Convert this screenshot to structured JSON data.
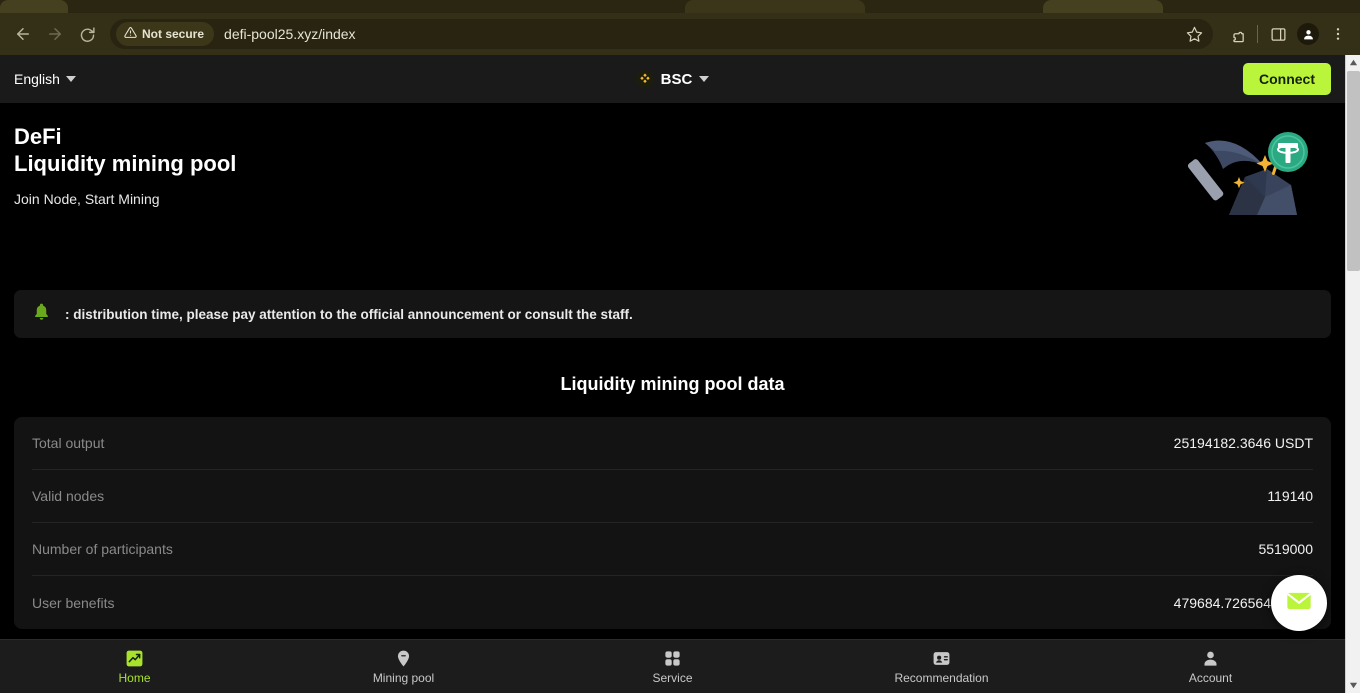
{
  "browser": {
    "back_label": "Back",
    "forward_label": "Forward",
    "reload_label": "Reload",
    "security_badge": "Not secure",
    "url": "defi-pool25.xyz/index",
    "bookmark_label": "Bookmark this tab",
    "extensions_label": "Extensions",
    "sidepanel_label": "Side panel",
    "profile_label": "Profile",
    "menu_label": "Customize and control Google Chrome",
    "icons": {
      "back": "arrow-left-icon",
      "forward": "arrow-right-icon",
      "reload": "reload-icon",
      "warning": "warning-triangle-icon",
      "star": "star-icon",
      "extensions": "puzzle-icon",
      "sidepanel": "side-panel-icon",
      "profile": "person-icon",
      "menu": "three-dot-menu-icon"
    }
  },
  "appbar": {
    "language": "English",
    "chain": "BSC",
    "chain_icon": "binance-logo-icon",
    "connect": "Connect",
    "connect_color": "#baf53c"
  },
  "hero": {
    "title_line1": "DeFi",
    "title_line2": "Liquidity mining pool",
    "subtitle": "Join Node, Start Mining",
    "art_icon": "pickaxe-mining-usdt-icon",
    "usdt_color": "#26a17b"
  },
  "notice": {
    "icon": "bell-icon",
    "icon_color": "#6aa81e",
    "text": ": distribution time, please pay attention to the official announcement or consult the staff."
  },
  "pool": {
    "section_title": "Liquidity mining pool data",
    "rows": [
      {
        "label": "Total output",
        "value": "25194182.3646 USDT"
      },
      {
        "label": "Valid nodes",
        "value": "119140"
      },
      {
        "label": "Number of participants",
        "value": "5519000"
      },
      {
        "label": "User benefits",
        "value": "479684.726564 USDT"
      }
    ]
  },
  "fab": {
    "name": "message-button",
    "icon": "envelope-icon",
    "icon_color": "#baf53c"
  },
  "bottom_nav": {
    "items": [
      {
        "label": "Home",
        "icon": "chart-line-icon",
        "active": true
      },
      {
        "label": "Mining pool",
        "icon": "pickaxe-pin-icon",
        "active": false
      },
      {
        "label": "Service",
        "icon": "grid-apps-icon",
        "active": false
      },
      {
        "label": "Recommendation",
        "icon": "contact-card-icon",
        "active": false
      },
      {
        "label": "Account",
        "icon": "person-icon",
        "active": false
      }
    ],
    "active_color": "#a8e22c"
  }
}
